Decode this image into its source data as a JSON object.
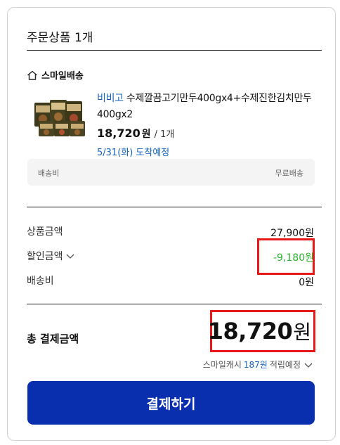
{
  "header": {
    "title": "주문상품 1개"
  },
  "shipping_type": {
    "label": "스마일배송",
    "icon": "home-icon"
  },
  "product": {
    "brand": "비비고",
    "name": " 수제깔끔고기만두400gx4+수제진한김치만두400gx2",
    "price": "18,720",
    "price_unit": "원",
    "quantity": "/ 1개",
    "arrival": "5/31(화) 도착예정"
  },
  "shipping_fee": {
    "label": "배송비",
    "value": "무료배송"
  },
  "summary": {
    "product_amount_label": "상품금액",
    "product_amount_value": "27,900원",
    "discount_label": "할인금액",
    "discount_value": "-9,180원",
    "shipping_label": "배송비",
    "shipping_value": "0원"
  },
  "total": {
    "label": "총 결제금액",
    "amount": "18,720",
    "unit": "원"
  },
  "smile_cash": {
    "prefix": "스마일캐시",
    "amount": "187원",
    "suffix": "적립예정"
  },
  "pay_button": {
    "label": "결제하기"
  },
  "colors": {
    "accent_blue": "#1565c0",
    "button": "#0a2fae",
    "discount": "#2bb52b",
    "highlight": "#e81818"
  }
}
